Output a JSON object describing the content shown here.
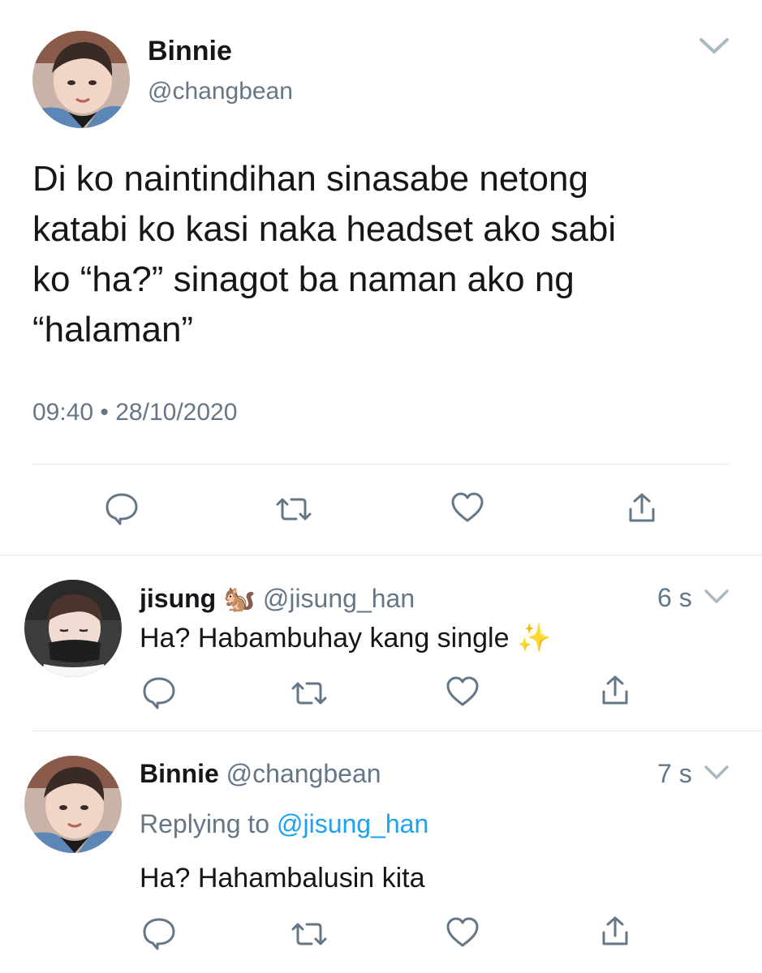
{
  "main_tweet": {
    "name": "Binnie",
    "handle": "@changbean",
    "lines": [
      "Di ko naintindihan sinasabe netong",
      "katabi ko kasi naka headset ako sabi",
      "ko “ha?” sinagot ba naman ako ng",
      "“halaman”"
    ],
    "timestamp": "09:40 • 28/10/2020",
    "actions": [
      "reply-icon",
      "retweet-icon",
      "like-icon",
      "share-icon"
    ]
  },
  "replies": [
    {
      "name": "jisung",
      "emoji": "🐿️",
      "handle": "@jisung_han",
      "time": "6 s",
      "text": "Ha? Habambuhay kang single",
      "text_emoji": "✨"
    },
    {
      "name": "Binnie",
      "handle": "@changbean",
      "time": "7 s",
      "replying_prefix": "Replying to",
      "replying_to": "@jisung_han",
      "text": "Ha? Hahambalusin kita"
    }
  ],
  "colors": {
    "text": "#14171a",
    "muted": "#657786",
    "link": "#1da1f2",
    "divider": "#e1e8ed"
  }
}
